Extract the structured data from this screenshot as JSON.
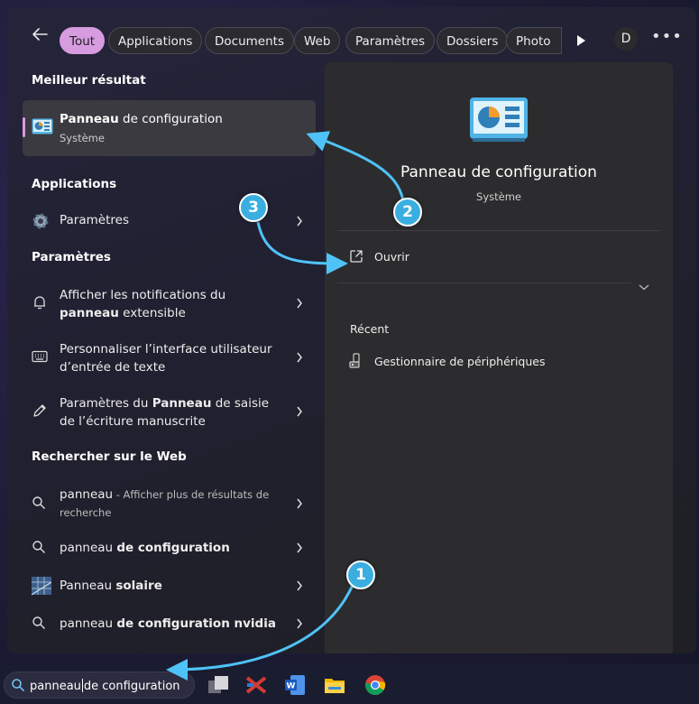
{
  "filters": {
    "tabs": [
      {
        "label": "Tout",
        "active": true
      },
      {
        "label": "Applications"
      },
      {
        "label": "Documents"
      },
      {
        "label": "Web"
      },
      {
        "label": "Paramètres"
      },
      {
        "label": "Dossiers"
      },
      {
        "label": "Photo"
      }
    ],
    "avatar_initial": "D",
    "more_label": "•••"
  },
  "best_match": {
    "section": "Meilleur résultat",
    "title_bold": "Panneau",
    "title_rest": " de configuration",
    "subtitle": "Système"
  },
  "applications": {
    "section": "Applications",
    "items": [
      {
        "label": "Paramètres",
        "icon": "gear-icon"
      }
    ]
  },
  "settings": {
    "section": "Paramètres",
    "items": [
      {
        "pre": "Afficher les notifications du ",
        "bold": "panneau",
        "post": " extensible",
        "icon": "bell-icon"
      },
      {
        "pre": "Personnaliser l’interface utilisateur d’entrée de texte",
        "bold": "",
        "post": "",
        "icon": "keyboard-icon"
      },
      {
        "pre": "Paramètres du ",
        "bold": "Panneau",
        "post": " de saisie de l’écriture manuscrite",
        "icon": "pen-icon"
      }
    ]
  },
  "web": {
    "section": "Rechercher sur le Web",
    "items": [
      {
        "plain": "panneau",
        "bold": "",
        "small": " - Afficher plus de résultats de recherche",
        "icon": "search-icon"
      },
      {
        "plain": "panneau ",
        "bold": "de configuration",
        "small": "",
        "icon": "search-icon"
      },
      {
        "plain": "Panneau ",
        "bold": "solaire",
        "small": "",
        "icon": "solar-panel-thumbnail"
      },
      {
        "plain": "panneau ",
        "bold": "de configuration nvidia",
        "small": "",
        "icon": "search-icon"
      }
    ]
  },
  "details": {
    "title": "Panneau de configuration",
    "subtitle": "Système",
    "open_label": "Ouvrir",
    "recent_title": "Récent",
    "recent_items": [
      {
        "label": "Gestionnaire de périphériques",
        "icon": "device-manager-icon"
      }
    ]
  },
  "taskbar": {
    "search_typed": "panneau",
    "search_rest": "de configuration",
    "apps": [
      "task-view-icon",
      "vs-code-icon",
      "word-icon",
      "file-explorer-icon",
      "chrome-icon"
    ]
  },
  "annotations": {
    "badges": [
      "1",
      "2",
      "3"
    ],
    "color": "#3aaee0"
  },
  "colors": {
    "accent": "#d79be0",
    "panel": "#202028",
    "detail_panel": "#2c2c2e"
  }
}
